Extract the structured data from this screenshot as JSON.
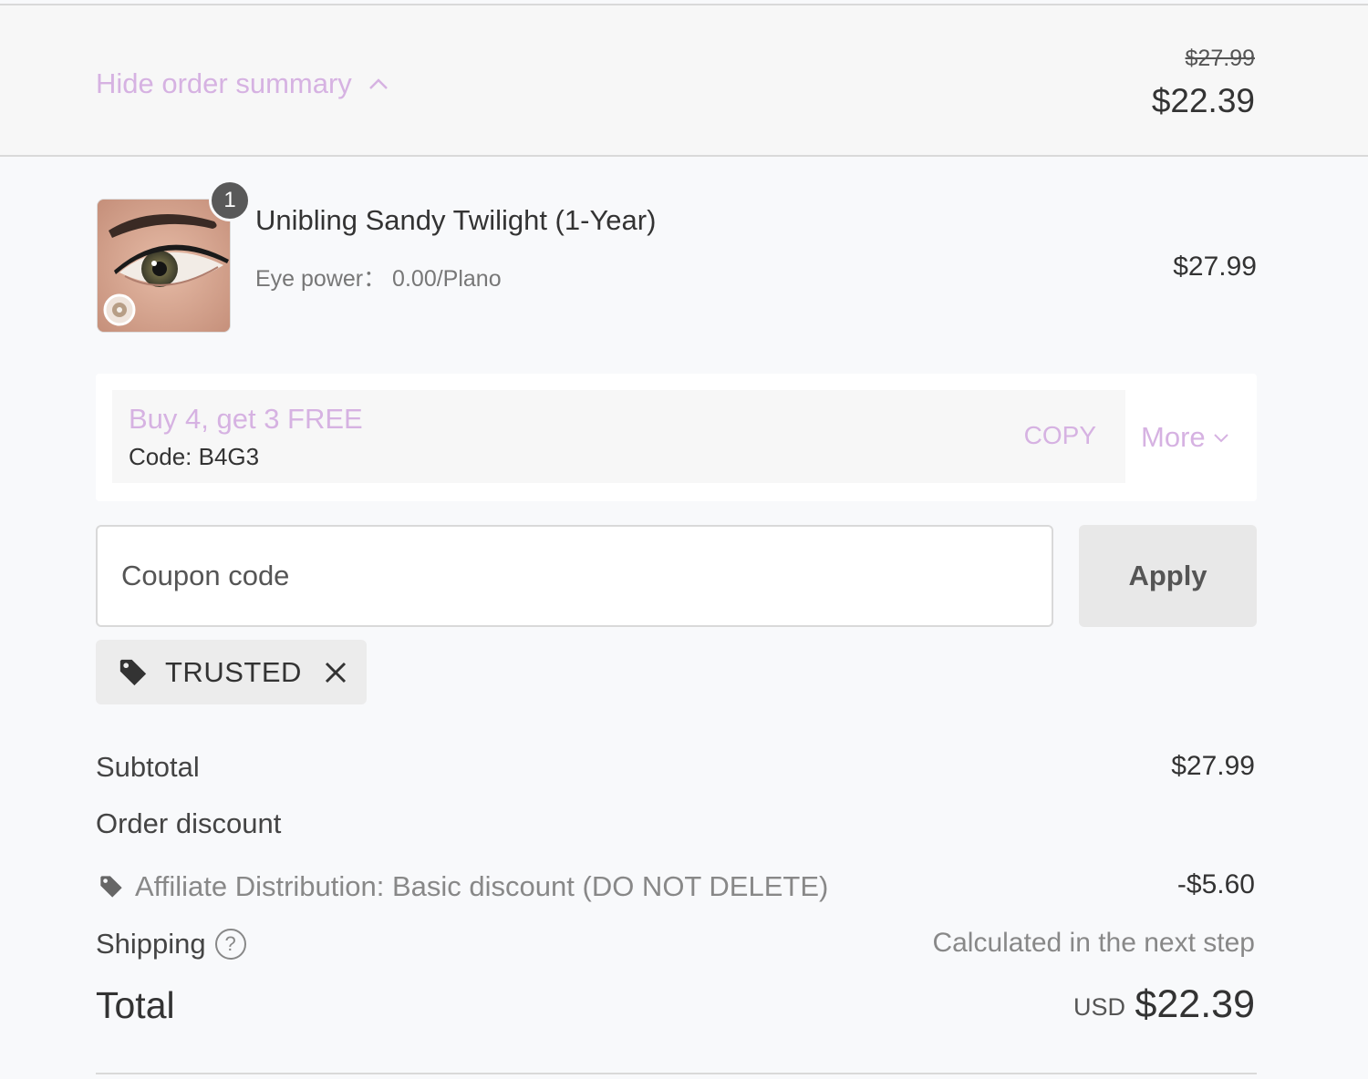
{
  "summary": {
    "toggle_label": "Hide order summary",
    "original_price": "$27.99",
    "current_price": "$22.39"
  },
  "product": {
    "quantity": "1",
    "name": "Unibling Sandy Twilight (1-Year)",
    "variant": "Eye power： 0.00/Plano",
    "price": "$27.99",
    "image_icon": "eye-contact-lens-icon"
  },
  "promo": {
    "title": "Buy 4, get 3 FREE",
    "code": "Code: B4G3",
    "copy_label": "COPY",
    "more_label": "More"
  },
  "coupon": {
    "placeholder": "Coupon code",
    "apply_label": "Apply"
  },
  "applied_tag": {
    "label": "TRUSTED"
  },
  "totals": {
    "subtotal_label": "Subtotal",
    "subtotal_value": "$27.99",
    "order_discount_label": "Order discount",
    "discount_name": "Affiliate Distribution: Basic discount (DO NOT DELETE)",
    "discount_value": "-$5.60",
    "shipping_label": "Shipping",
    "shipping_value": "Calculated in the next step",
    "total_label": "Total",
    "currency": "USD",
    "total_value": "$22.39"
  },
  "colors": {
    "accent": "#d6b2e2",
    "text": "#333333",
    "muted": "#888888",
    "panel": "#f7f7f7"
  }
}
